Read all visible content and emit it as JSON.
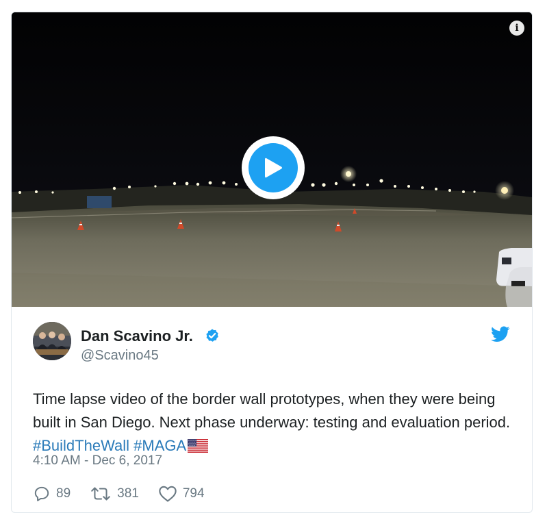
{
  "tweet": {
    "display_name": "Dan Scavino Jr.",
    "handle": "@Scavino45",
    "text_before": "Time lapse video of the border wall prototypes, when they were being built in San Diego. Next phase underway: testing and evaluation period. ",
    "hashtag_1": "#BuildTheWall",
    "hashtag_2": "#MAGA",
    "timestamp": "4:10 AM - Dec 6, 2017",
    "reply_count": "89",
    "retweet_count": "381",
    "like_count": "794",
    "verified": true
  },
  "media": {
    "info_icon": "info-icon",
    "play_icon": "play-icon",
    "info_glyph": "i"
  },
  "colors": {
    "brand": "#1da1f2",
    "hashtag": "#2b7bb9",
    "secondary_text": "#697882",
    "border": "#e1e8ed"
  }
}
